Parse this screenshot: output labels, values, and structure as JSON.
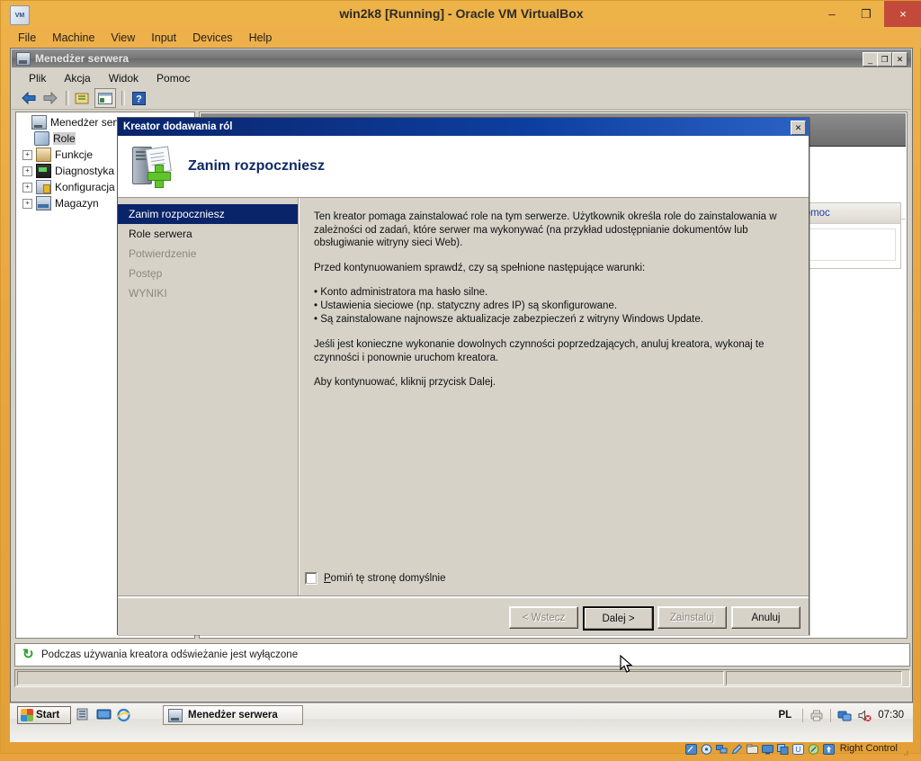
{
  "vbox": {
    "title": "win2k8 [Running] - Oracle VM VirtualBox",
    "app_icon": "virtualbox-vm-icon",
    "window_buttons": {
      "minimize": "–",
      "maximize": "❐",
      "close": "×"
    },
    "menus": [
      "File",
      "Machine",
      "View",
      "Input",
      "Devices",
      "Help"
    ],
    "statusbar": {
      "icons": [
        "harddisk-icon",
        "optical-disk-icon",
        "network-icon",
        "usb-pen-icon",
        "shared-folder-icon",
        "display-icon",
        "shared-clipboard-icon",
        "recording-icon",
        "mouse-integration-icon",
        "host-key-icon"
      ],
      "host_key_label": "Right Control",
      "grip": "resize-grip"
    }
  },
  "server_manager": {
    "title": "Menedżer serwera",
    "title_icon": "server-manager-icon",
    "system_buttons": {
      "minimize": "_",
      "maximize": "❐",
      "close": "✕"
    },
    "menus": [
      "Plik",
      "Akcja",
      "Widok",
      "Pomoc"
    ],
    "toolbar": [
      {
        "name": "back-icon",
        "glyph": "⬅"
      },
      {
        "name": "forward-icon",
        "glyph": "➡"
      },
      {
        "name": "show-hide-console-tree-icon",
        "glyph": "🗂"
      },
      {
        "name": "properties-icon",
        "glyph": "🗔"
      },
      {
        "name": "help-icon",
        "glyph": "?"
      }
    ],
    "tree": [
      {
        "label": "Menedżer serwera",
        "icon": "server-manager-node-icon",
        "expander": "",
        "indent": 0,
        "selected": false
      },
      {
        "label": "Role",
        "icon": "roles-node-icon",
        "expander": "",
        "indent": 1,
        "selected": true
      },
      {
        "label": "Funkcje",
        "icon": "features-node-icon",
        "expander": "+",
        "indent": 1,
        "selected": false
      },
      {
        "label": "Diagnostyka",
        "icon": "diagnostics-node-icon",
        "expander": "+",
        "indent": 1,
        "selected": false
      },
      {
        "label": "Konfiguracja",
        "icon": "configuration-node-icon",
        "expander": "+",
        "indent": 1,
        "selected": false
      },
      {
        "label": "Magazyn",
        "icon": "storage-node-icon",
        "expander": "+",
        "indent": 1,
        "selected": false
      }
    ],
    "help_panel_title": "Pomoc",
    "status_text": "Podczas używania kreatora odświeżanie jest wyłączone",
    "status_icon": "refresh-disabled-icon"
  },
  "wizard": {
    "window_title": "Kreator dodawania ról",
    "close_button": "✕",
    "header_icon": "add-roles-server-tag-icon",
    "header_title": "Zanim rozpoczniesz",
    "steps": [
      {
        "label": "Zanim rozpoczniesz",
        "state": "active"
      },
      {
        "label": "Role serwera",
        "state": "done"
      },
      {
        "label": "Potwierdzenie",
        "state": "pending"
      },
      {
        "label": "Postęp",
        "state": "pending"
      },
      {
        "label": "WYNIKI",
        "state": "pending"
      }
    ],
    "body": {
      "intro": "Ten kreator pomaga zainstalować role na tym serwerze. Użytkownik określa role do zainstalowania w zależności od zadań, które serwer ma wykonywać (na przykład udostępnianie dokumentów lub obsługiwanie witryny sieci Web).",
      "prereq_heading": "Przed kontynuowaniem sprawdź, czy są spełnione następujące warunki:",
      "bullets": [
        "• Konto administratora ma hasło silne.",
        "• Ustawienia sieciowe (np. statyczny adres IP) są skonfigurowane.",
        "• Są zainstalowane najnowsze aktualizacje zabezpieczeń z witryny Windows Update."
      ],
      "note": "Jeśli jest konieczne wykonanie dowolnych czynności poprzedzających, anuluj kreatora, wykonaj te czynności i ponownie uruchom kreatora.",
      "continue": "Aby kontynuować, kliknij przycisk Dalej."
    },
    "skip_checkbox": {
      "checked": false,
      "label_prefix": "P",
      "label_rest": "omiń tę stronę domyślnie"
    },
    "buttons": [
      {
        "name": "back-button",
        "label": "< Wstecz",
        "state": "disabled"
      },
      {
        "name": "next-button",
        "label": "Dalej >",
        "state": "default"
      },
      {
        "name": "install-button",
        "label": "Zainstaluj",
        "state": "disabled"
      },
      {
        "name": "cancel-button",
        "label": "Anuluj",
        "state": "normal"
      }
    ]
  },
  "vm_taskbar": {
    "start_label": "Start",
    "quick_launch": [
      "server-manager-quicklaunch-icon",
      "show-desktop-icon",
      "internet-explorer-icon"
    ],
    "task_button": {
      "label": "Menedżer serwera",
      "icon": "server-manager-taskbar-icon"
    },
    "tray": {
      "language": "PL",
      "printer_icon": "printer-icon",
      "network_icon": "network-icon",
      "volume_icon": "volume-muted-icon",
      "clock": "07:30"
    }
  },
  "colors": {
    "vbox_frame": "#e8a33d",
    "vbox_close": "#c34a3a",
    "wizard_titlebar": "#0a246a",
    "dialog_face": "#d6d2c8",
    "nav_active": "#0a246a",
    "header_title": "#0d2a66",
    "pomoc_link": "#1e3f9e",
    "status_green": "#2aa02a"
  }
}
